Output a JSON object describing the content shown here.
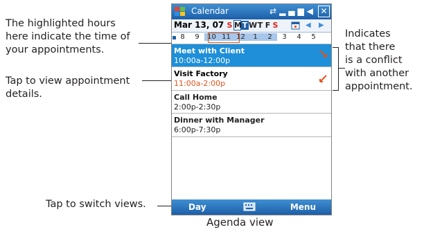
{
  "callouts": {
    "highlighted_hours": "The highlighted hours\nhere indicate the time of\nyour appointments.",
    "tap_details": "Tap to view appointment\ndetails.",
    "tap_switch": "Tap to switch views.",
    "conflict": "Indicates\nthat there\nis a conflict\nwith another\nappointment."
  },
  "caption": "Agenda view",
  "phone": {
    "title": "Calendar",
    "date": "Mar 13, 07",
    "days": [
      "S",
      "M",
      "T",
      "W",
      "T",
      "F",
      "S"
    ],
    "hours": [
      "8",
      "9",
      "10",
      "11",
      "12",
      "1",
      "2",
      "3",
      "4",
      "5"
    ],
    "appointments": [
      {
        "title": "Meet with Client",
        "time": "10:00a-12:00p"
      },
      {
        "title": "Visit Factory",
        "time": "11:00a-2:00p"
      },
      {
        "title": "Call Home",
        "time": "2:00p-2:30p"
      },
      {
        "title": "Dinner with Manager",
        "time": "6:00p-7:30p"
      }
    ],
    "menubar": {
      "left": "Day",
      "right": "Menu"
    }
  },
  "colors": {
    "accent": "#1d5fa8",
    "selected_row": "#1e8fd8",
    "conflict": "#e5531c",
    "weekend": "#d9261c"
  }
}
